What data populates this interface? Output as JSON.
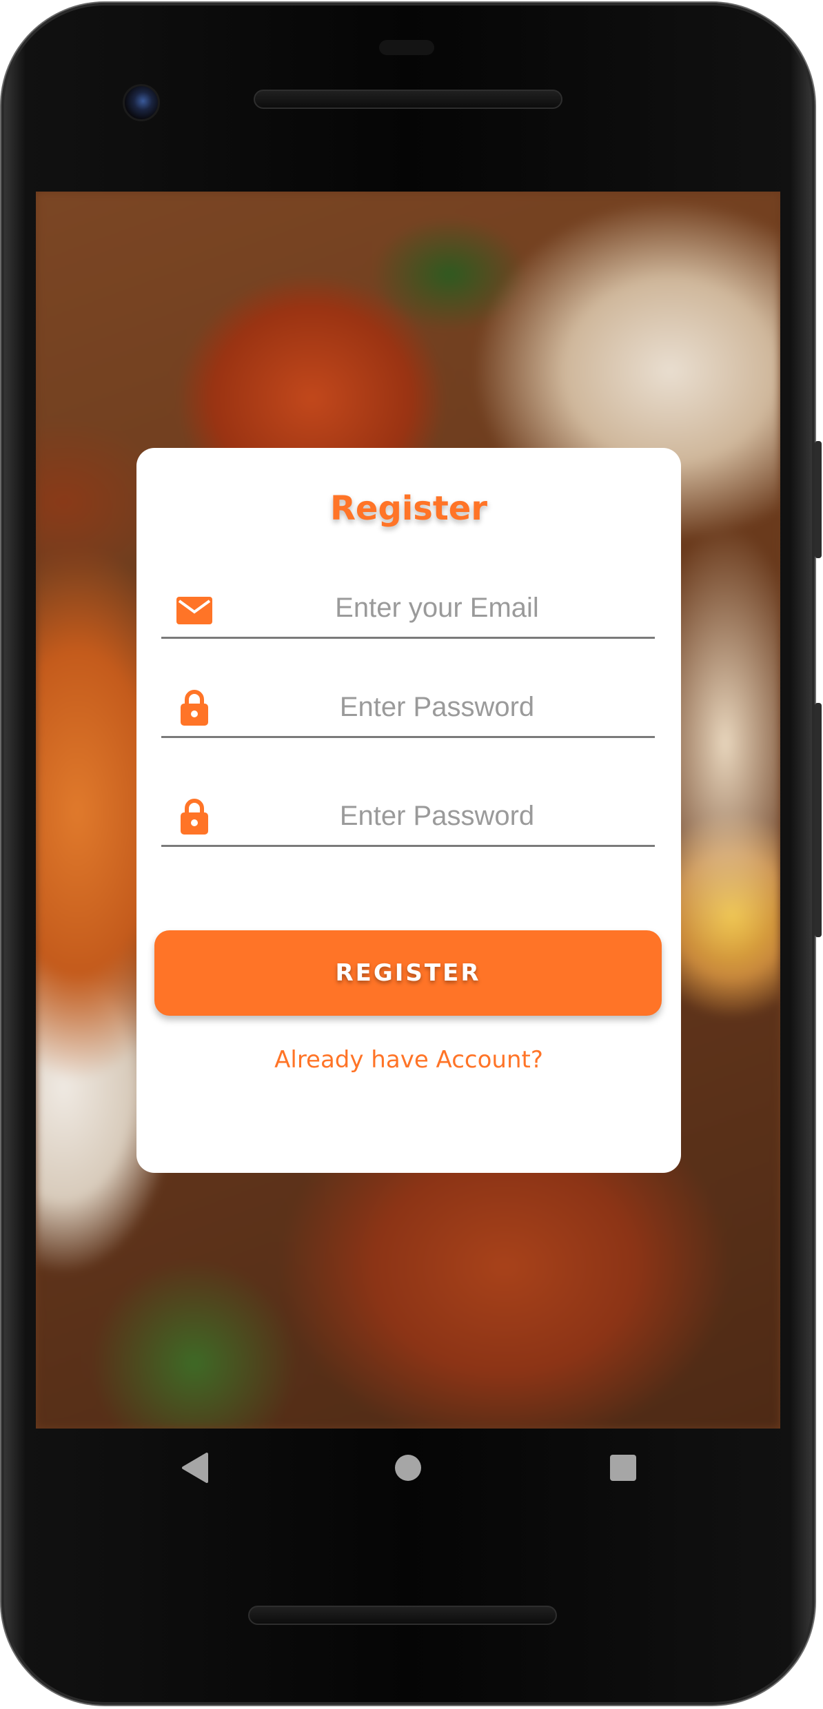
{
  "register_form": {
    "title": "Register",
    "email_placeholder": "Enter your Email",
    "password_placeholder": "Enter Password",
    "confirm_password_placeholder": "Enter Password",
    "submit_label": "REGISTER",
    "login_link": "Already have Account?"
  },
  "colors": {
    "accent": "#ff7427",
    "card": "#ffffff",
    "placeholder": "#9a9a9a"
  },
  "icons": {
    "email": "envelope-icon",
    "password": "lock-icon",
    "confirm_password": "lock-icon",
    "nav_back": "back-triangle-icon",
    "nav_home": "home-circle-icon",
    "nav_recents": "recents-square-icon"
  }
}
